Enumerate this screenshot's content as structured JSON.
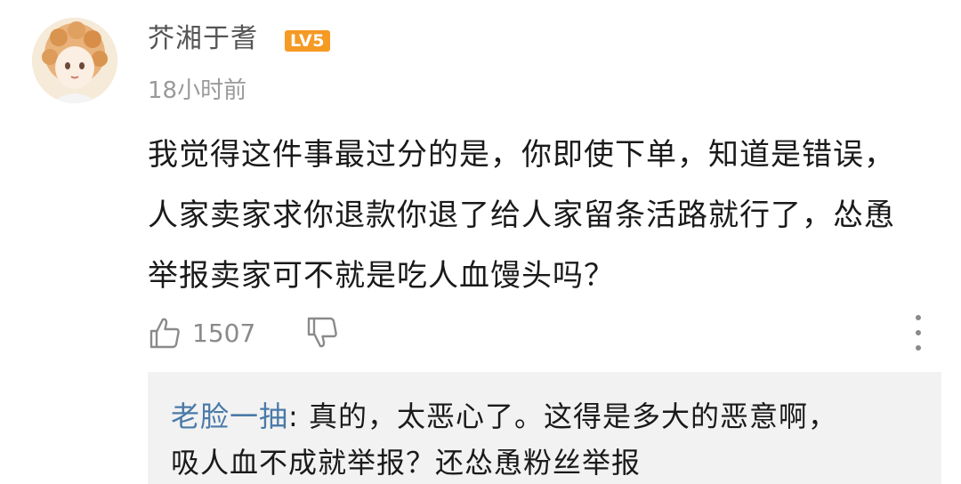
{
  "comment": {
    "username": "芥湘于耆",
    "level_badge": "LV5",
    "timestamp": "18小时前",
    "text_lines": [
      "我觉得这件事最过分的是，你即使下单，知道是错误，",
      "人家卖家求你退款你退了给人家留条活路就行了，怂恿",
      "举报卖家可不就是吃人血馒头吗？"
    ],
    "likes": "1507",
    "icons": {
      "like": "thumbs-up-icon",
      "dislike": "thumbs-down-icon",
      "more": "more-vertical-icon"
    }
  },
  "reply": {
    "author": "老脸一抽",
    "separator": ": ",
    "text_lines": [
      "真的，太恶心了。这得是多大的恶意啊，",
      "吸人血不成就举报？还怂恿粉丝举报"
    ]
  },
  "colors": {
    "level_badge": "#f59a23",
    "reply_author": "#4a7aa8",
    "reply_background": "#f2f2f2"
  }
}
